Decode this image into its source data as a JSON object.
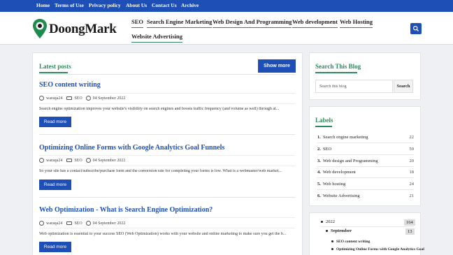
{
  "top_nav": [
    "Home",
    "Terms of Use",
    "Privacy policy",
    "About Us",
    "Contact Us",
    "Archive"
  ],
  "site": {
    "logo": "DoongMark"
  },
  "main_nav": [
    "SEO",
    "Search Engine Marketing",
    "Web Design And Programming",
    "Web development",
    "Web Hosting",
    "Website Advertising"
  ],
  "latest": {
    "heading": "Latest posts",
    "show_more": "Show more",
    "read_more": "Read more",
    "posts": [
      {
        "title": "SEO content writing",
        "author": "waraqa24",
        "label": "SEO",
        "date": "04 September 2022",
        "snippet": "Search engine optimization improves your website's visibility on search engines and boosts traffic frequency (and volume as well) through al..."
      },
      {
        "title": "Optimizing Online Forms with Google Analytics Goal Funnels",
        "author": "waraqa24",
        "label": "SEO",
        "date": "04 September 2022",
        "snippet": "So your site has a contact/subscribe/purchase form and the conversion rate for completing your forms is low. What is a webmaster/web market..."
      },
      {
        "title": "Web Optimization - What is Search Engine Optimization?",
        "author": "waraqa24",
        "label": "SEO",
        "date": "04 September 2022",
        "snippet": "Web optimization is essential to your success SEO (Web Optimization) works with your website and online marketing to make sure you get the b..."
      }
    ]
  },
  "search_blog": {
    "heading": "Search This Blog",
    "placeholder": "Search this blog",
    "button": "Search"
  },
  "labels": {
    "heading": "Labels",
    "items": [
      {
        "num": "1.",
        "name": "Search engine marketing",
        "count": "22"
      },
      {
        "num": "2.",
        "name": "SEO",
        "count": "59"
      },
      {
        "num": "3.",
        "name": "Web design and Programming",
        "count": "20"
      },
      {
        "num": "4.",
        "name": "Web development",
        "count": "18"
      },
      {
        "num": "5.",
        "name": "Web hosting",
        "count": "24"
      },
      {
        "num": "6.",
        "name": "Website Advertising",
        "count": "21"
      }
    ]
  },
  "archive": {
    "year": "2022",
    "year_count": "164",
    "month": "September",
    "month_count": "13",
    "posts": [
      "SEO content writing",
      "Optimizing Online Forms with Google Analytics Goal"
    ]
  },
  "colors": {
    "primary": "#1d4fb7",
    "accent": "#2d8a5a"
  }
}
